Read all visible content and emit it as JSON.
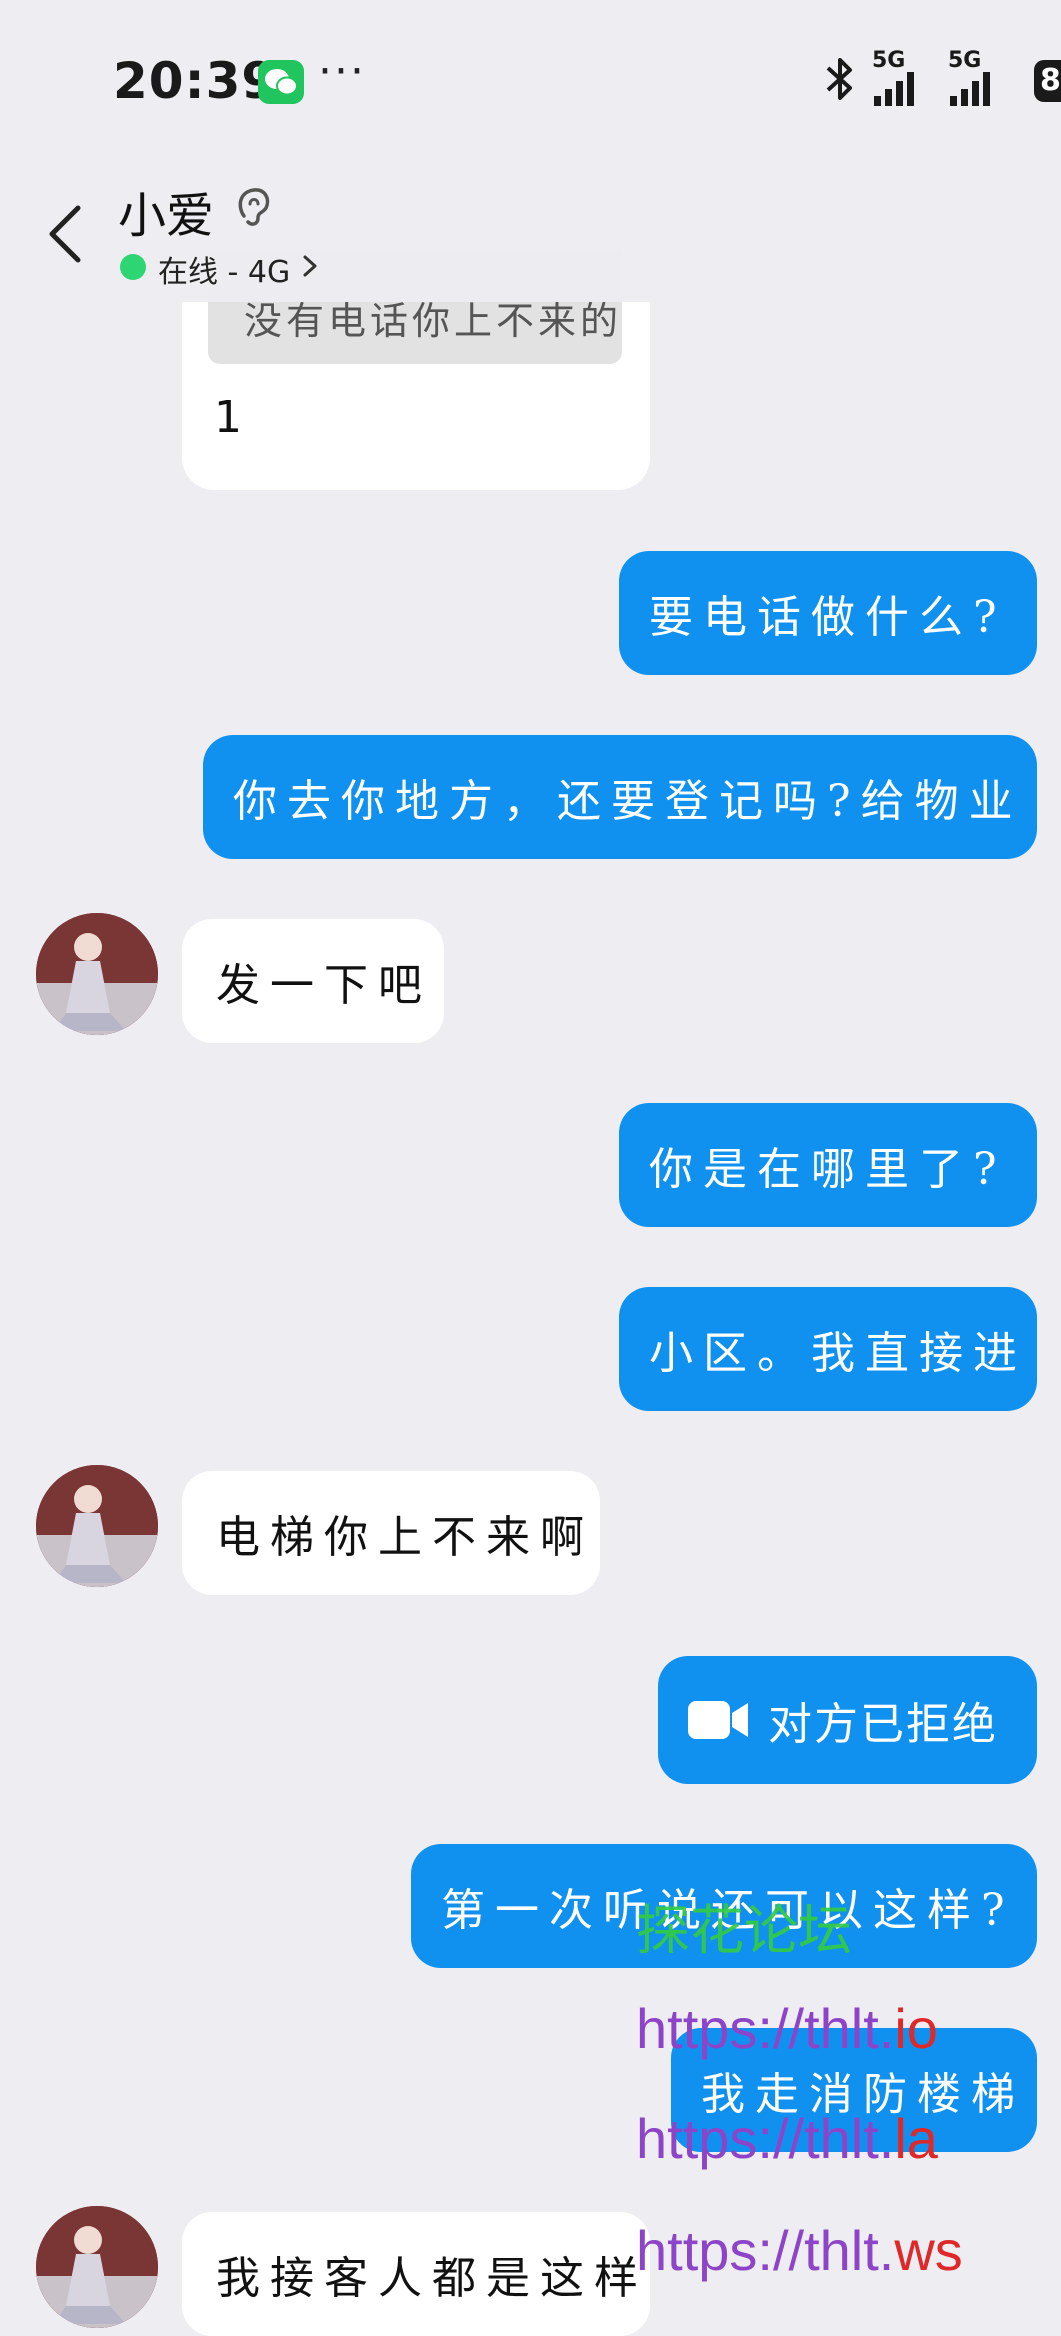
{
  "status_bar": {
    "time": "20:39",
    "dots": "···",
    "network_1": "5G",
    "network_2": "5G",
    "battery_partial": "8"
  },
  "header": {
    "contact_name": "小爱",
    "status": "在线 - 4G"
  },
  "quote": {
    "quoted_text": "没有电话你上不来的",
    "reply": "1"
  },
  "messages": [
    {
      "side": "sent",
      "text": "要电话做什么?"
    },
    {
      "side": "sent",
      "text": "你去你地方，还要登记吗?给物业"
    },
    {
      "side": "recv",
      "text": "发一下吧"
    },
    {
      "side": "sent",
      "text": "你是在哪里了?"
    },
    {
      "side": "sent",
      "text": "小区。我直接进"
    },
    {
      "side": "recv",
      "text": "电梯你上不来啊"
    },
    {
      "side": "sent",
      "text": "对方已拒绝",
      "icon": "video-call-icon"
    },
    {
      "side": "sent",
      "text": "第一次听说还可以这样?"
    },
    {
      "side": "sent",
      "text": "我走消防楼梯"
    },
    {
      "side": "recv",
      "text": "我接客人都是这样"
    }
  ],
  "watermark": {
    "title": "探花论坛",
    "links": [
      {
        "prefix": "https://thlt.",
        "suffix": "io"
      },
      {
        "prefix": "https://thlt.",
        "suffix": "la"
      },
      {
        "prefix": "https://thlt.",
        "suffix": "ws"
      }
    ]
  },
  "colors": {
    "sent_bubble": "#1091F0",
    "recv_bubble": "#FFFFFF",
    "background": "#EDEDF2",
    "online": "#2ED573",
    "wechat": "#21C55D"
  }
}
